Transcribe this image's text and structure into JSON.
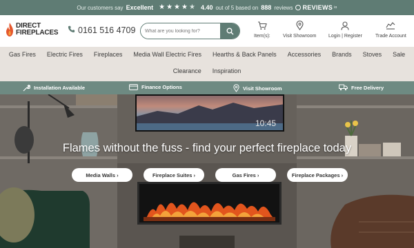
{
  "topbar": {
    "prefix": "Our customers say",
    "rating_word": "Excellent",
    "rating_value": 4.4,
    "score_text": "4.40",
    "out_of_text": "out of 5 based on",
    "review_count": "888",
    "reviews_word": "reviews",
    "brand": "REVIEWS",
    "brand_suffix": "io"
  },
  "header": {
    "logo_line1": "DIRECT",
    "logo_line2": "FIREPLACES",
    "phone": "0161 516 4709",
    "search_placeholder": "What are you looking for?",
    "items": [
      {
        "label": "Item(s):",
        "icon": "cart-icon"
      },
      {
        "label": "Visit Showroom",
        "icon": "location-pin-icon"
      },
      {
        "label": "Login | Register",
        "icon": "user-icon"
      },
      {
        "label": "Trade Account",
        "icon": "trade-icon"
      }
    ]
  },
  "nav": {
    "row1": [
      "Gas Fires",
      "Electric Fires",
      "Fireplaces",
      "Media Wall Electric Fires",
      "Hearths & Back Panels",
      "Accessories",
      "Brands",
      "Stoves",
      "Sale"
    ],
    "row2": [
      "Clearance",
      "Inspiration"
    ]
  },
  "benefits": [
    {
      "label": "Installation Available",
      "icon": "wrench-icon"
    },
    {
      "label": "Finance Options",
      "icon": "card-icon"
    },
    {
      "label": "Visit Showroom",
      "icon": "location-pin-icon"
    },
    {
      "label": "Free Delivery",
      "icon": "truck-icon"
    }
  ],
  "hero": {
    "title": "Flames without the fuss - find your perfect fireplace today",
    "tv_time": "10:45",
    "buttons": [
      "Media Walls ›",
      "Fireplace Suites ›",
      "Gas Fires ›",
      "Fireplace Packages ›"
    ]
  },
  "colors": {
    "accent": "#5f7c74",
    "benefits_bg": "#6e8a82",
    "nav_bg": "#e7e2dd",
    "logo_flame": "#e4572e"
  }
}
